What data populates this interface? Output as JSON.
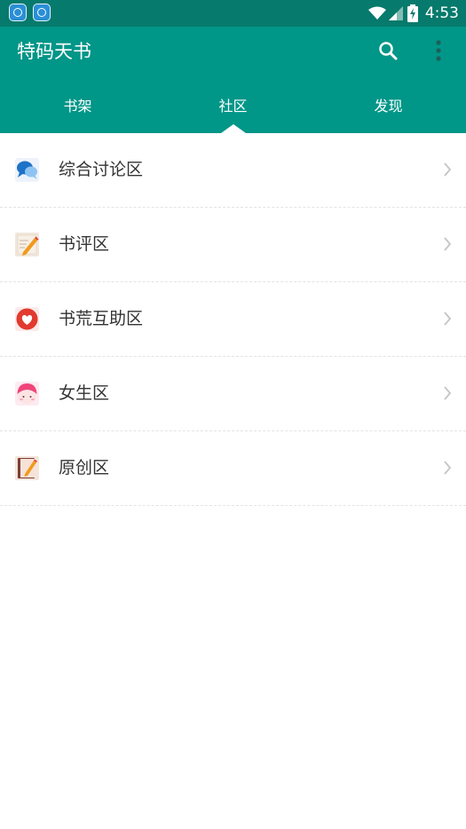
{
  "status_bar": {
    "time": "4:53",
    "notifications": [
      "app-notification-icon",
      "app-notification-icon"
    ],
    "indicators": [
      "wifi-icon",
      "cell-signal-icon",
      "battery-charging-icon"
    ]
  },
  "app_bar": {
    "title": "特码天书",
    "actions": [
      "search-icon",
      "more-vert-icon"
    ],
    "background": "#009688"
  },
  "tabs": [
    {
      "label": "书架",
      "selected": false
    },
    {
      "label": "社区",
      "selected": true
    },
    {
      "label": "发现",
      "selected": false
    }
  ],
  "list": {
    "items": [
      {
        "label": "综合讨论区",
        "icon": "chat-bubbles-icon"
      },
      {
        "label": "书评区",
        "icon": "pen-note-icon"
      },
      {
        "label": "书荒互助区",
        "icon": "heart-icon"
      },
      {
        "label": "女生区",
        "icon": "girl-face-icon"
      },
      {
        "label": "原创区",
        "icon": "book-pen-icon"
      }
    ]
  },
  "colors": {
    "primary": "#009688",
    "status_bar": "#067a6c",
    "text": "#333333",
    "chevron": "#c4c4c4"
  }
}
